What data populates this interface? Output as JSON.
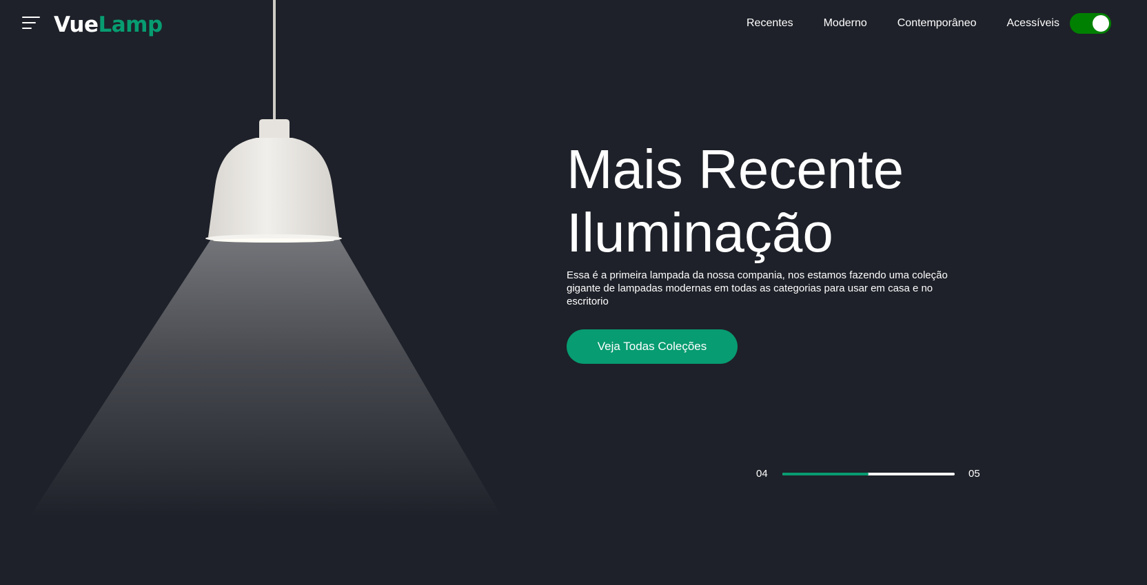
{
  "header": {
    "logo": {
      "part1": "Vue",
      "part2": "Lamp"
    },
    "nav": [
      {
        "label": "Recentes"
      },
      {
        "label": "Moderno"
      },
      {
        "label": "Contemporâneo"
      },
      {
        "label": "Acessíveis"
      }
    ],
    "theme_toggle": {
      "on": true
    }
  },
  "hero": {
    "title_line1": "Mais Recente",
    "title_line2": "Iluminação",
    "description": "Essa é a primeira lampada da nossa compania, nos estamos fazendo uma coleção gigante de lampadas modernas em todas as categorias para usar em casa e no escritorio",
    "cta_label": "Veja Todas Coleções"
  },
  "slider": {
    "current": "04",
    "total": "05",
    "progress": 0.5
  },
  "colors": {
    "background": "#1e2129",
    "accent": "#079c71",
    "toggle": "#008000",
    "white": "#ffffff"
  },
  "icons": {
    "menu": "menu-icon",
    "lamp": "pendant-lamp"
  }
}
